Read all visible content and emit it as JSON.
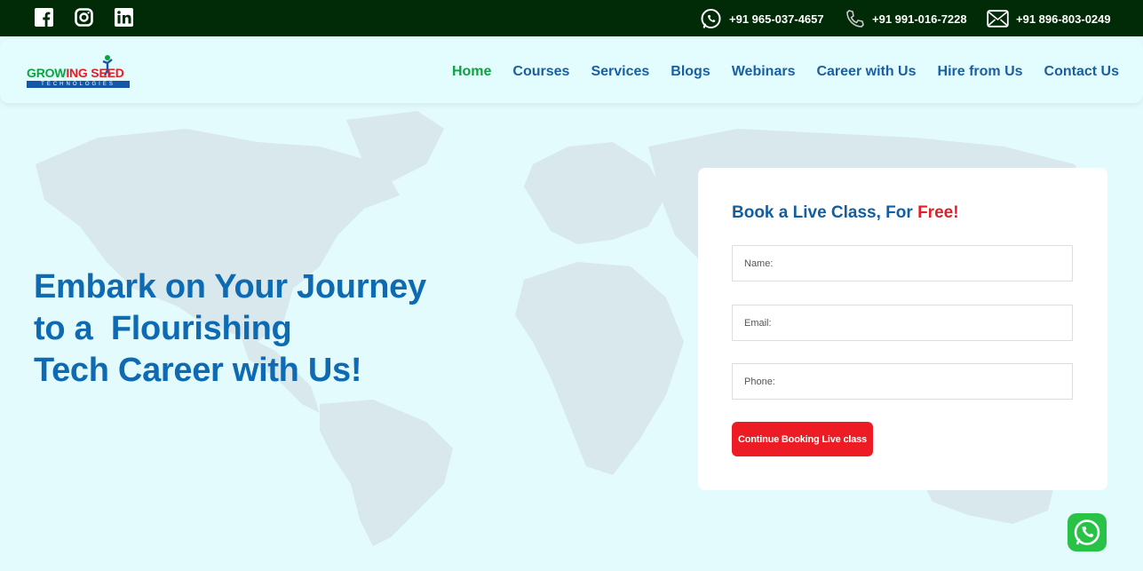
{
  "topbar": {
    "social": [
      "facebook-icon",
      "instagram-icon",
      "linkedin-icon"
    ],
    "contacts": [
      {
        "icon": "whatsapp-icon",
        "text": "+91 965-037-4657"
      },
      {
        "icon": "phone-icon",
        "text": "+91 991-016-7228"
      },
      {
        "icon": "mail-icon",
        "text": "+91 896-803-0249"
      }
    ]
  },
  "logo": {
    "part1": "GROW",
    "part2": "NG SEED",
    "tagline": "TECHNOLOGIES"
  },
  "nav": {
    "items": [
      "Home",
      "Courses",
      "Services",
      "Blogs",
      "Webinars",
      "Career with Us",
      "Hire from Us",
      "Contact Us"
    ],
    "active": "Home"
  },
  "hero": {
    "lines": [
      "Embark on Your Journey",
      "to a  Flourishing",
      "Tech Career with Us!"
    ]
  },
  "form": {
    "title": "Book a Live Class, For ",
    "title_highlight": "Free!",
    "name_placeholder": "Name:",
    "email_placeholder": "Email:",
    "phone_placeholder": "Phone:",
    "button": "Continue Booking Live class"
  },
  "colors": {
    "topbar": "#012a07",
    "accent_blue": "#0d6ab3",
    "accent_green": "#0aa43f",
    "accent_red": "#ed1c24",
    "background": "#e3fbfd"
  }
}
